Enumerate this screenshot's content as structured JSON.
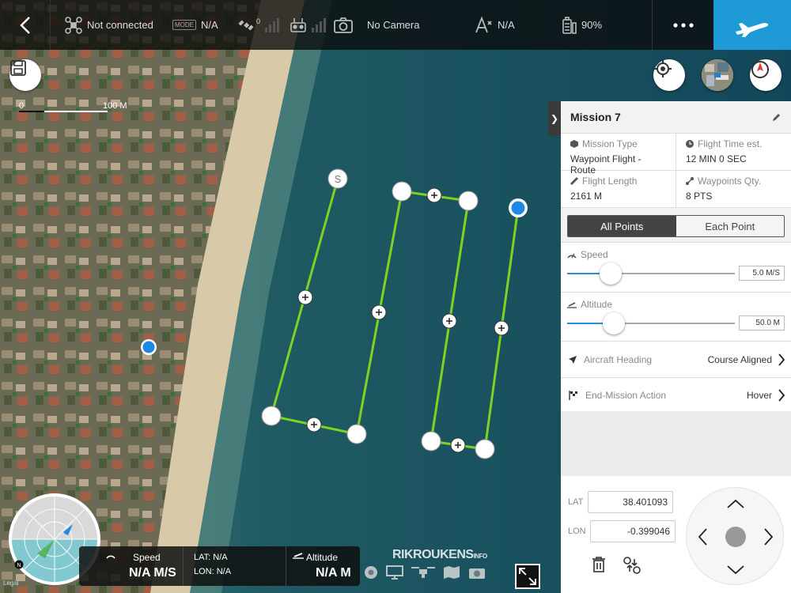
{
  "topbar": {
    "connection": "Not connected",
    "mode_badge": "MODE",
    "mode_value": "N/A",
    "satellites": "0",
    "camera": "No Camera",
    "signal_value": "N/A",
    "battery": "90%",
    "icons": [
      "back-chevron-icon",
      "drone-icon",
      "mode-icon",
      "satellite-icon",
      "remote-controller-icon",
      "camera-icon",
      "signal-icon",
      "battery-icon",
      "more-icon",
      "takeoff-plane-icon"
    ]
  },
  "map": {
    "scale_left": "0",
    "scale_right": "100 M",
    "waypoint_start_label": "S",
    "colors": {
      "route": "#7ed321",
      "aircraft": "#1e88e5",
      "accent": "#1e9bd7"
    }
  },
  "mission": {
    "title": "Mission 7",
    "type_label": "Mission Type",
    "type_value": "Waypoint Flight - Route",
    "time_label": "Flight Time est.",
    "time_value": "12 MIN 0 SEC",
    "length_label": "Flight Length",
    "length_value": "2161 M",
    "qty_label": "Waypoints Qty.",
    "qty_value": "8 PTS",
    "tab_all": "All Points",
    "tab_each": "Each Point",
    "speed_label": "Speed",
    "speed_value": "5.0 M/S",
    "speed_fraction": 0.26,
    "altitude_label": "Altitude",
    "altitude_value": "50.0 M",
    "altitude_fraction": 0.28,
    "heading_label": "Aircraft Heading",
    "heading_value": "Course Aligned",
    "end_label": "End-Mission Action",
    "end_value": "Hover",
    "lat_label": "LAT",
    "lat_value": "38.401093",
    "lon_label": "LON",
    "lon_value": "-0.399046"
  },
  "telemetry": {
    "speed_label": "Speed",
    "speed_value": "N/A M/S",
    "lat": "LAT: N/A",
    "lon": "LON: N/A",
    "altitude_label": "Altitude",
    "altitude_value": "N/A M"
  },
  "brand": {
    "name": "RIKROUKENS",
    "suffix": "INFO"
  },
  "legal": "Legal",
  "radar": {
    "north": "N"
  }
}
